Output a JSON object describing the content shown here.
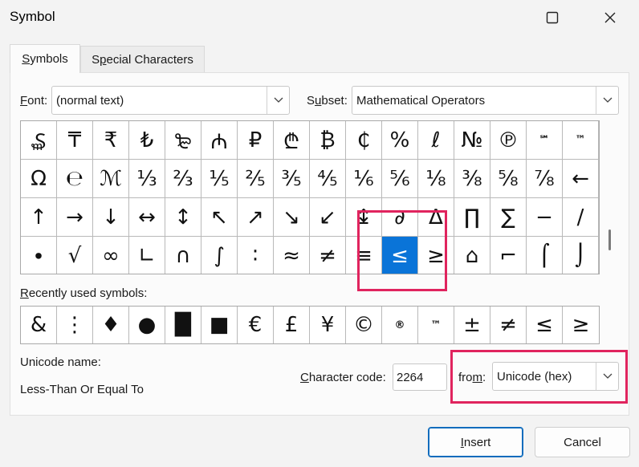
{
  "window": {
    "title": "Symbol"
  },
  "tabs": [
    {
      "label_u": "S",
      "label_rest": "ymbols",
      "active": true
    },
    {
      "label_pre": "S",
      "label_u": "p",
      "label_rest": "ecial Characters",
      "active": false
    }
  ],
  "font": {
    "label_u": "F",
    "label_rest": "ont:",
    "value": "(normal text)"
  },
  "subset": {
    "label_pre": "S",
    "label_u": "u",
    "label_rest": "bset:",
    "value": "Mathematical Operators"
  },
  "symbols_grid": [
    [
      "₷",
      "₸",
      "₹",
      "₺",
      "₻",
      "₼",
      "₽",
      "₾",
      "₿",
      "₵",
      "%",
      "ℓ",
      "№",
      "℗",
      "℠",
      "™"
    ],
    [
      "Ω",
      "℮",
      "ℳ",
      "⅓",
      "⅔",
      "⅕",
      "⅖",
      "⅗",
      "⅘",
      "⅙",
      "⅚",
      "⅛",
      "⅜",
      "⅝",
      "⅞",
      "←"
    ],
    [
      "↑",
      "→",
      "↓",
      "↔",
      "↕",
      "↖",
      "↗",
      "↘",
      "↙",
      "↨",
      "∂",
      "∆",
      "∏",
      "∑",
      "−",
      "∕"
    ],
    [
      "∙",
      "√",
      "∞",
      "∟",
      "∩",
      "∫",
      "∶",
      "≈",
      "≠",
      "≡",
      "≤",
      "≥",
      "⌂",
      "⌐",
      "⌠",
      "⌡"
    ]
  ],
  "selected": {
    "row": 3,
    "col": 10
  },
  "small_symbols": [
    "℠",
    "™",
    "®"
  ],
  "recent": {
    "label_u": "R",
    "label_rest": "ecently used symbols:",
    "symbols": [
      "&",
      "⋮",
      "♦",
      "●",
      "█",
      "■",
      "€",
      "£",
      "¥",
      "©",
      "®",
      "™",
      "±",
      "≠",
      "≤",
      "≥"
    ]
  },
  "unicode_name": {
    "label": "Unicode name:",
    "value": "Less-Than Or Equal To"
  },
  "char_code": {
    "label_u": "C",
    "label_rest": "haracter code:",
    "value": "2264"
  },
  "from": {
    "label_pre": "fro",
    "label_u": "m",
    "label_rest": ":",
    "value": "Unicode (hex)"
  },
  "buttons": {
    "insert_u": "I",
    "insert_rest": "nsert",
    "cancel": "Cancel"
  },
  "colors": {
    "selection": "#0a74d8",
    "highlight": "#e0245e"
  }
}
